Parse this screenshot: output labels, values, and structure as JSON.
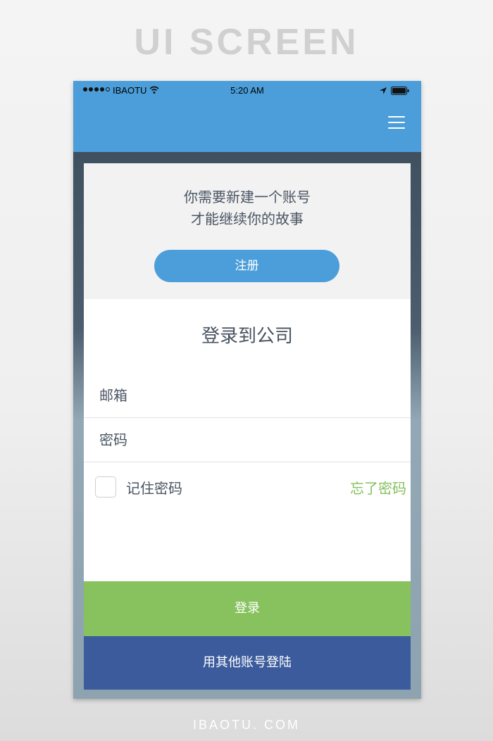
{
  "page": {
    "header_title": "UI SCREEN",
    "footer_brand": "IBAOTU. COM"
  },
  "status_bar": {
    "carrier": "IBAOTU",
    "time": "5:20 AM",
    "signal_bars": 4,
    "icons": [
      "signal-icon",
      "wifi-icon",
      "location-icon",
      "battery-icon"
    ]
  },
  "navbar": {
    "menu_icon": "hamburger-menu-icon"
  },
  "signup": {
    "line1": "你需要新建一个账号",
    "line2": "才能继续你的故事",
    "register_label": "注册"
  },
  "login": {
    "title": "登录到公司",
    "email_placeholder": "邮箱",
    "password_placeholder": "密码",
    "remember_label": "记住密码",
    "remember_checked": false,
    "forgot_label": "忘了密码",
    "login_label": "登录",
    "other_label": "用其他账号登陆"
  },
  "colors": {
    "primary_blue": "#4b9ed9",
    "green": "#87c25f",
    "dark_blue": "#3b5b9c",
    "text": "#4a5563"
  }
}
